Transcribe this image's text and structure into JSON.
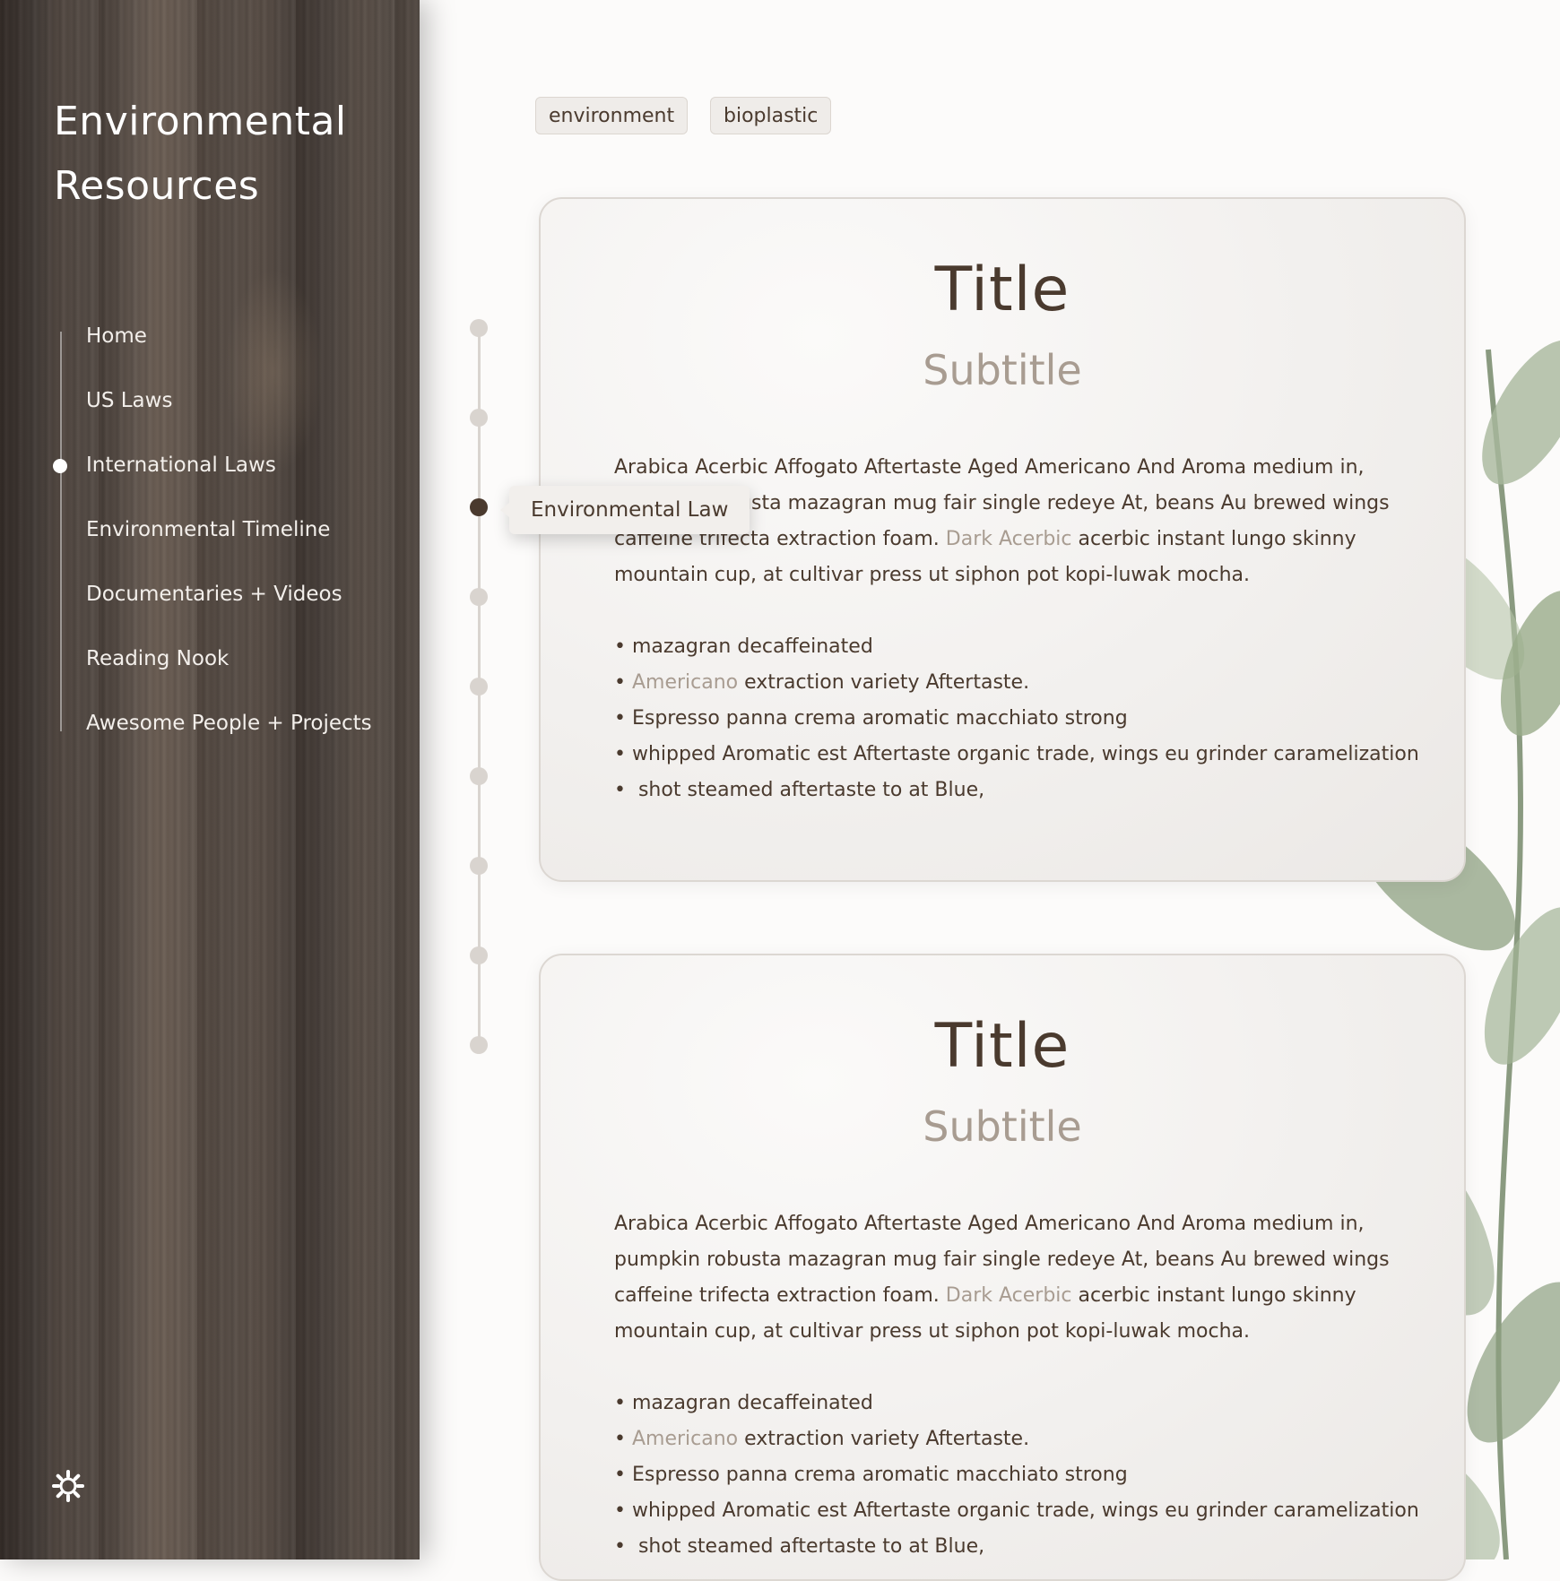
{
  "sidebar": {
    "title_line1": "Environmental",
    "title_line2": "Resources",
    "nav": [
      {
        "label": "Home"
      },
      {
        "label": "US Laws"
      },
      {
        "label": "International Laws"
      },
      {
        "label": "Environmental Timeline"
      },
      {
        "label": "Documentaries + Videos"
      },
      {
        "label": "Reading Nook"
      },
      {
        "label": "Awesome People + Projects"
      }
    ],
    "active_index": 2,
    "settings_icon": "gear-icon"
  },
  "tags": [
    "environment",
    "bioplastic"
  ],
  "timeline": {
    "dot_count": 9,
    "active_index": 2,
    "tooltip": "Environmental Law"
  },
  "cards": [
    {
      "title": "Title",
      "subtitle": "Subtitle",
      "para_a": "Arabica Acerbic Affogato Aftertaste Aged Americano And Aroma medium in, pumpkin robusta mazagran mug fair single redeye At, beans Au brewed wings caffeine trifecta extraction foam. ",
      "para_link": "Dark Acerbic",
      "para_b": " acerbic instant lungo skinny mountain cup, at cultivar press ut siphon pot kopi-luwak mocha.",
      "bullets": [
        {
          "pre": "• ",
          "hl": "",
          "text": "mazagran decaffeinated"
        },
        {
          "pre": "• ",
          "hl": "Americano",
          "text": " extraction variety Aftertaste."
        },
        {
          "pre": "• ",
          "hl": "",
          "text": "Espresso panna crema aromatic macchiato strong"
        },
        {
          "pre": "• ",
          "hl": "",
          "text": "whipped Aromatic est Aftertaste organic trade, wings eu grinder caramelization"
        },
        {
          "pre": "•  ",
          "hl": "",
          "text": "shot steamed aftertaste to at Blue,"
        }
      ]
    },
    {
      "title": "Title",
      "subtitle": "Subtitle",
      "para_a": "Arabica Acerbic Affogato Aftertaste Aged Americano And Aroma medium in, pumpkin robusta mazagran mug fair single redeye At, beans Au brewed wings caffeine trifecta extraction foam. ",
      "para_link": "Dark Acerbic",
      "para_b": " acerbic instant lungo skinny mountain cup, at cultivar press ut siphon pot kopi-luwak mocha.",
      "bullets": [
        {
          "pre": "• ",
          "hl": "",
          "text": "mazagran decaffeinated"
        },
        {
          "pre": "• ",
          "hl": "Americano",
          "text": " extraction variety Aftertaste."
        },
        {
          "pre": "• ",
          "hl": "",
          "text": "Espresso panna crema aromatic macchiato strong"
        },
        {
          "pre": "• ",
          "hl": "",
          "text": "whipped Aromatic est Aftertaste organic trade, wings eu grinder caramelization"
        },
        {
          "pre": "•  ",
          "hl": "",
          "text": "shot steamed aftertaste to at Blue,"
        }
      ]
    }
  ]
}
